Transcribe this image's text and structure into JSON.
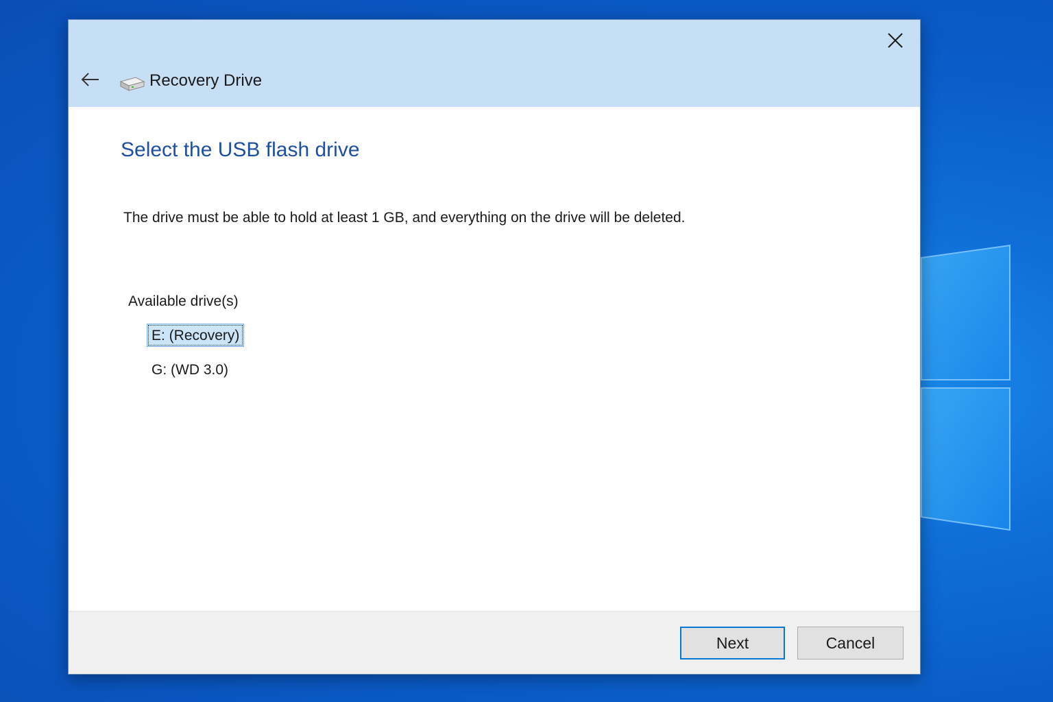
{
  "window": {
    "title": "Recovery Drive",
    "icons": {
      "close": "close-icon",
      "back": "back-arrow-icon",
      "app": "recovery-drive-icon"
    }
  },
  "page": {
    "heading": "Select the USB flash drive",
    "description": "The drive must be able to hold at least 1 GB, and everything on the drive will be deleted.",
    "drives_label": "Available drive(s)",
    "drives": [
      {
        "label": "E: (Recovery)",
        "selected": true
      },
      {
        "label": "G: (WD 3.0)",
        "selected": false
      }
    ]
  },
  "footer": {
    "next_label": "Next",
    "cancel_label": "Cancel"
  },
  "colors": {
    "header_bg": "#c7dff4",
    "heading_text": "#1f4fa0",
    "accent": "#0078d7",
    "desktop": "#0a5cc8"
  }
}
